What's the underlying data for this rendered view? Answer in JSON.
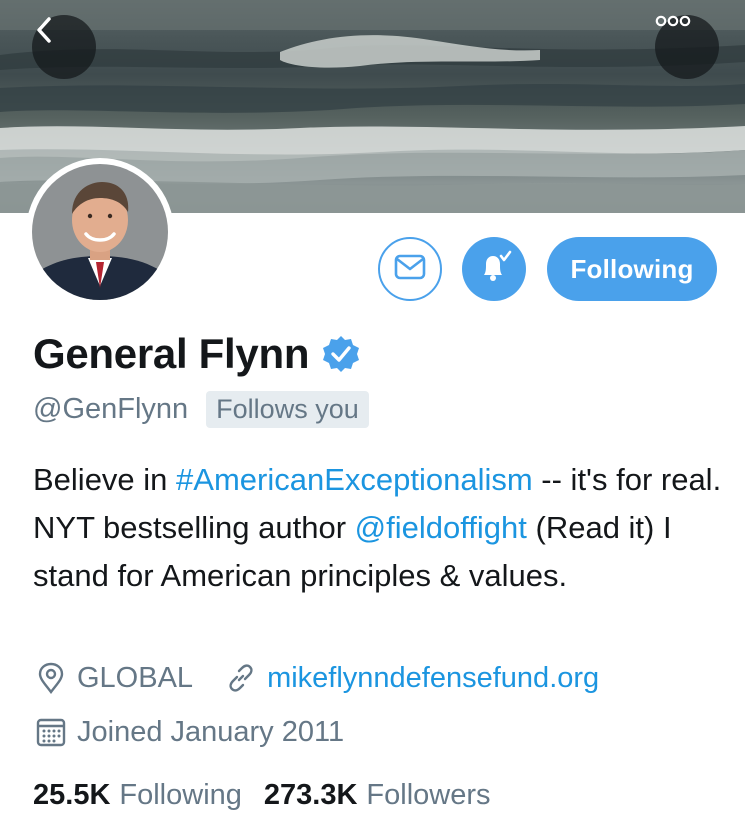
{
  "header": {
    "back_icon": "chevron-left-icon",
    "more_icon": "more-dots-icon"
  },
  "profile": {
    "display_name": "General Flynn",
    "verified": true,
    "handle": "@GenFlynn",
    "follows_you": "Follows you",
    "bio": {
      "part1": "Believe in ",
      "hashtag": "#AmericanExceptionalism",
      "part2": " -- it's for real. NYT bestselling author ",
      "mention": "@fieldoffight",
      "part3": " (Read it) I stand for American principles & values."
    },
    "location": "GLOBAL",
    "website": "mikeflynndefensefund.org",
    "joined": "Joined January 2011"
  },
  "actions": {
    "message_icon": "envelope-icon",
    "notify_icon": "bell-check-icon",
    "following_label": "Following"
  },
  "stats": {
    "following_count": "25.5K",
    "following_label": "Following",
    "followers_count": "273.3K",
    "followers_label": "Followers"
  },
  "colors": {
    "accent": "#4aa1eb",
    "link": "#1b95e0",
    "secondary_text": "#657786",
    "primary_text": "#14171a"
  }
}
